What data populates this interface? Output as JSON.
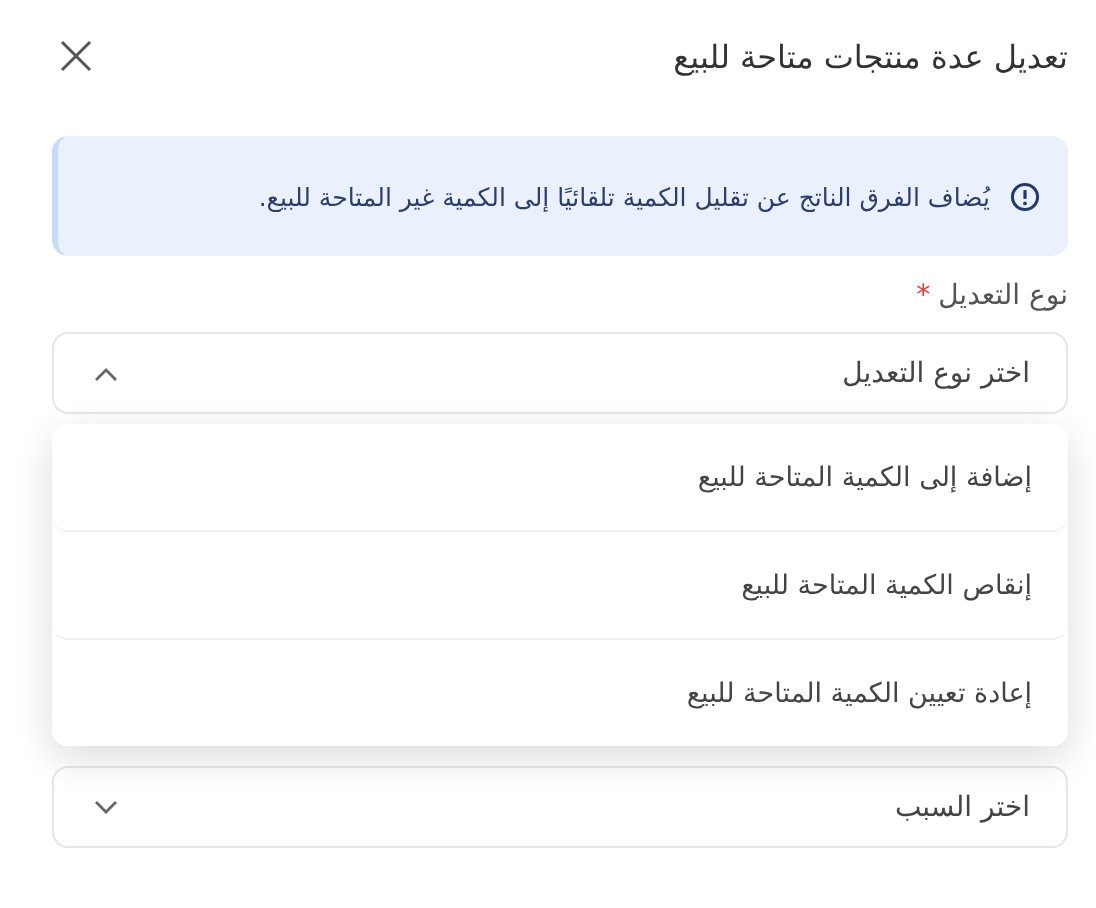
{
  "dialog": {
    "title": "تعديل عدة منتجات متاحة للبيع",
    "has_close": true
  },
  "alert": {
    "text": "يُضاف الفرق الناتج عن تقليل الكمية تلقائيًا إلى الكمية غير المتاحة للبيع."
  },
  "adjustment_type": {
    "label": "نوع التعديل",
    "required_mark": "*",
    "placeholder": "اختر نوع التعديل",
    "expanded": true,
    "options": [
      {
        "label": "إضافة إلى الكمية المتاحة للبيع",
        "selected": false
      },
      {
        "label": "إنقاص الكمية المتاحة للبيع",
        "selected": false
      },
      {
        "label": "إعادة تعيين الكمية المتاحة للبيع",
        "selected": false
      }
    ]
  },
  "reason": {
    "placeholder": "اختر السبب",
    "expanded": false
  }
}
